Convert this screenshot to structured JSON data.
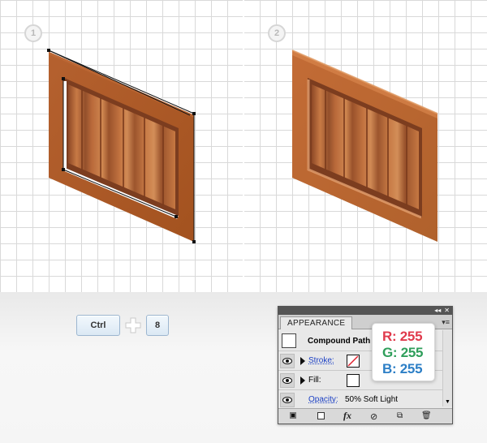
{
  "steps": {
    "one": "1",
    "two": "2"
  },
  "shortcut": {
    "key1": "Ctrl",
    "key2": "8"
  },
  "appearance": {
    "tab_label": "APPEARANCE",
    "object_label": "Compound Path",
    "stroke_label": "Stroke:",
    "fill_label": "Fill:",
    "opacity_label": "Opacity:",
    "opacity_value": "50% Soft Light",
    "fx_label": "fx"
  },
  "color_readout": {
    "r": "R: 255",
    "g": "G: 255",
    "b": "B: 255",
    "r_color": "#e03a4c",
    "g_color": "#2f9e5b",
    "b_color": "#2d7fc6"
  },
  "colors": {
    "wood_light": "#c9753c",
    "wood_dark": "#8a4524",
    "key_border": "#9cb6d0"
  }
}
